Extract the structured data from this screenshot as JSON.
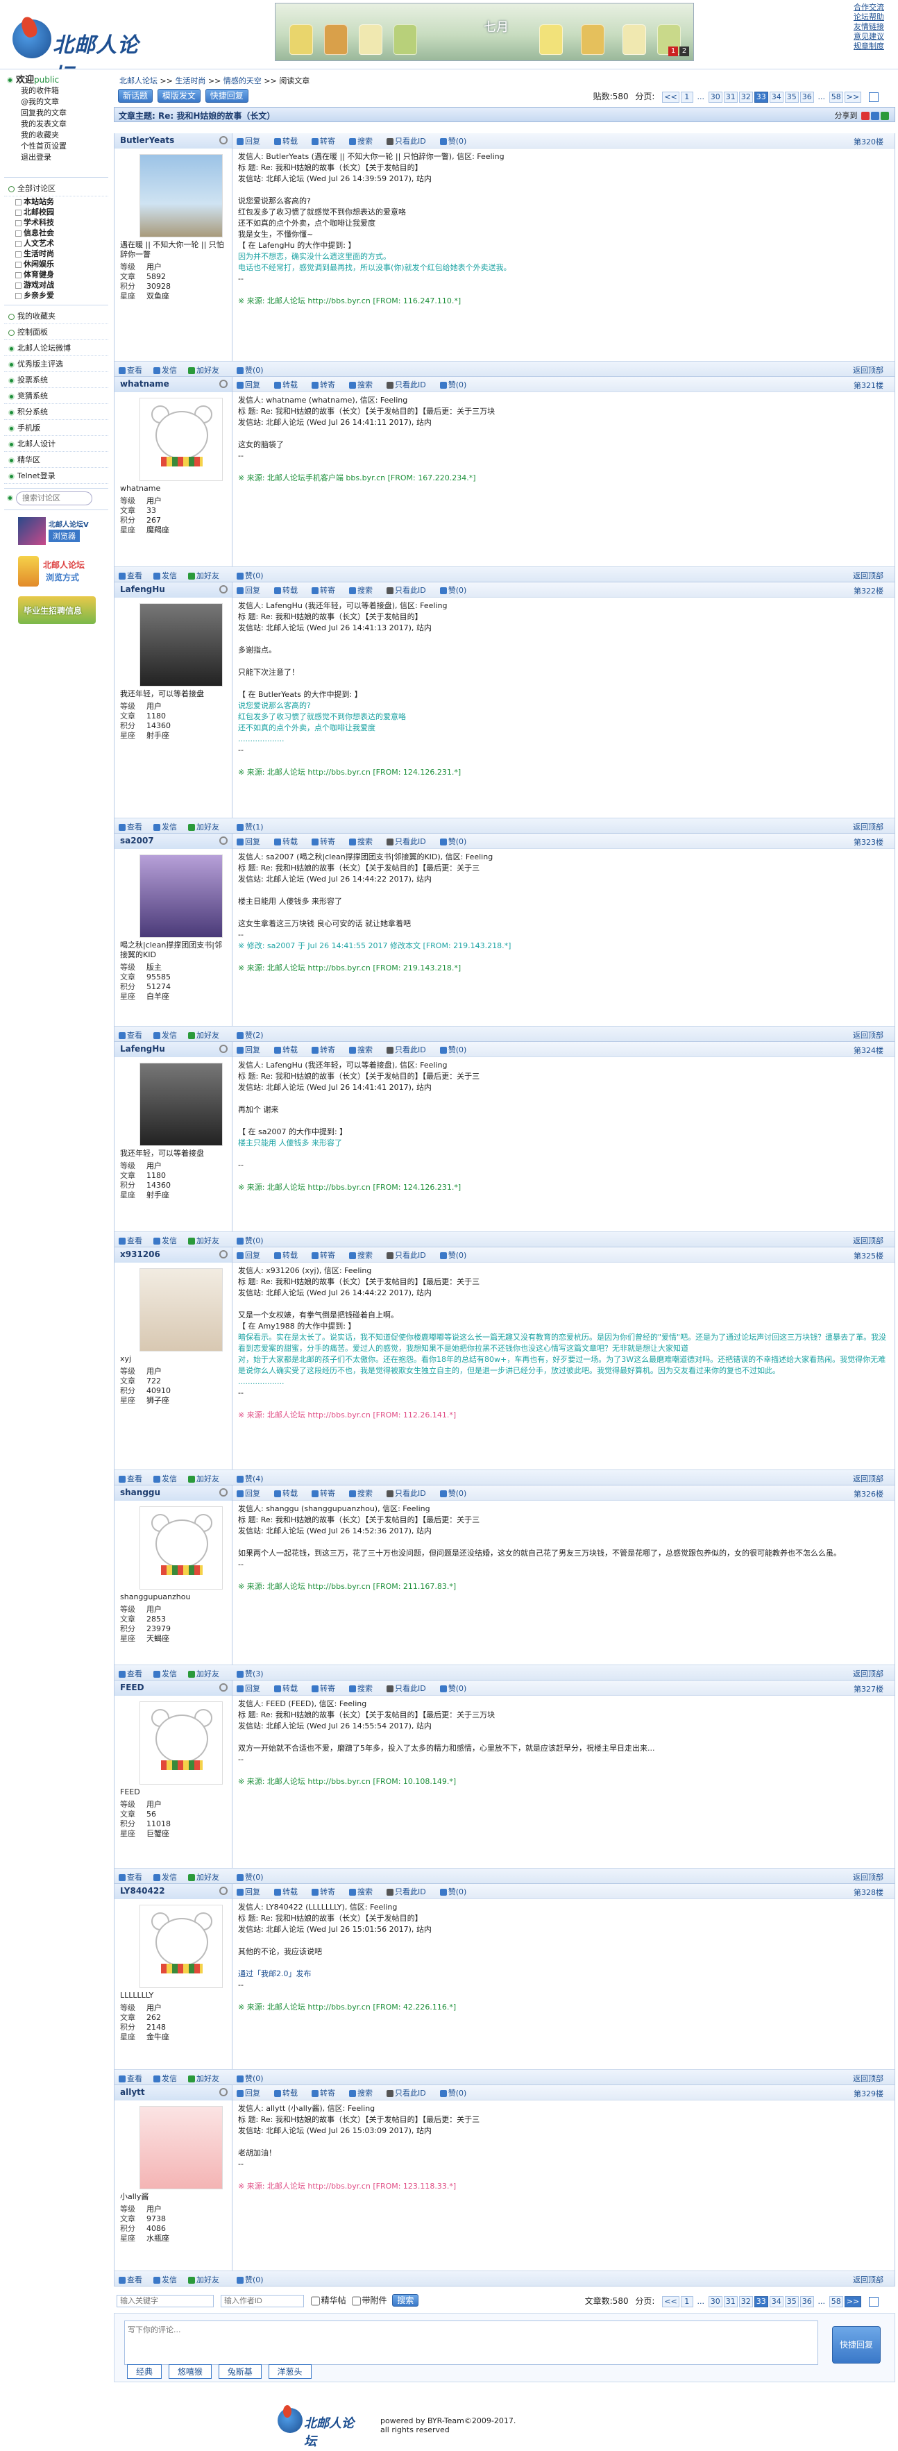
{
  "site": {
    "logo_text": "北邮人论坛"
  },
  "toplinks": [
    "合作交流",
    "论坛帮助",
    "友情链接",
    "意见建议",
    "规章制度"
  ],
  "banner": {
    "text": "七月",
    "nums": [
      "1",
      "2"
    ]
  },
  "sidebar": {
    "welcome": "欢迎",
    "public": "public",
    "user_links": [
      "我的收件箱",
      "@我的文章",
      "回复我的文章",
      "我的发表文章",
      "我的收藏夹",
      "个性首页设置",
      "退出登录"
    ],
    "all_sections": "全部讨论区",
    "sections": [
      "本站站务",
      "北邮校园",
      "学术科技",
      "信息社会",
      "人文艺术",
      "生活时尚",
      "休闲娱乐",
      "体育健身",
      "游戏对战",
      "乡亲乡爱"
    ],
    "items": [
      "我的收藏夹",
      "控制面板",
      "北邮人论坛微博",
      "优秀版主评选",
      "投票系统",
      "竞猜系统",
      "积分系统",
      "手机版",
      "北邮人设计",
      "精华区",
      "Telnet登录"
    ],
    "search_placeholder": "搜索讨论区",
    "promo1": "北邮人论坛V",
    "promo1b": "浏览器",
    "promo2": "北邮人论坛",
    "promo2b": "浏览方式",
    "promo3": "毕业生招聘信息"
  },
  "breadcrumb": [
    "北邮人论坛",
    ">>",
    "生活时尚",
    ">>",
    "情感的天空",
    ">>",
    "阅读文章"
  ],
  "toolbar": {
    "new_post": "新话题",
    "template_post": "模版发文",
    "quick_reply": "快捷回复",
    "post_count_label": "贴数:580",
    "pager_label": "分页:",
    "pages": [
      "<<",
      "1",
      "...",
      "30",
      "31",
      "32",
      "33",
      "34",
      "35",
      "36",
      "...",
      "58",
      ">>"
    ],
    "current": "33"
  },
  "title": "文章主题:  Re: 我和H姑娘的故事（长文）",
  "share_label": "分享到",
  "actions": [
    "回复",
    "转载",
    "转寄",
    "搜索",
    "只看此ID",
    "赞(0)"
  ],
  "foot_actions": [
    "查看",
    "发信",
    "加好友"
  ],
  "back_top": "返回顶部",
  "posts": [
    {
      "user": "ButlerYeats",
      "floor": "第320楼",
      "sig": "遇在暖 || 不知大你一轮 || 只怕辞你一瞥",
      "stats": {
        "等级": "用户",
        "文章": "5892",
        "积分": "30928",
        "星座": "双鱼座"
      },
      "like": "赞(0)",
      "lines": [
        "发信人: ButlerYeats (遇在暖 || 不知大你一轮 || 只怕辞你一瞥), 信区: Feeling",
        "标  题: Re: 我和H姑娘的故事（长文）【关于发帖目的】",
        "发信站: 北邮人论坛 (Wed Jul 26 14:39:59 2017), 站内",
        "",
        "说您爱说那么客高的?",
        "红包发多了收习惯了就感觉不到你想表达的爱意咯",
        "还不如真的点个外卖，点个咖啡让我爱度",
        "我是女生，不懂你懂~",
        "【 在 LafengHu 的大作中提到: 】"
      ],
      "quote": [
        "因为并不想恋，确实没什么遗这里面的方式。",
        "电话也不经常打，感觉调到最再找，所以没事(你)就发个红包给她表个外卖送我。"
      ],
      "after": [
        "--"
      ],
      "src": "※ 来源: 北邮人论坛 http://bbs.byr.cn [FROM: 116.247.110.*]"
    },
    {
      "user": "whatname",
      "floor": "第321楼",
      "sig": "whatname",
      "stats": {
        "等级": "用户",
        "文章": "33",
        "积分": "267",
        "星座": "魔羯座"
      },
      "like": "赞(0)",
      "lines": [
        "发信人: whatname (whatname), 信区: Feeling",
        "标  题: Re: 我和H姑娘的故事（长文）【关于发帖目的】【最后更：关于三万块",
        "发信站: 北邮人论坛 (Wed Jul 26 14:41:11 2017), 站内",
        "",
        "这女的脑袋了",
        "--"
      ],
      "quote": [],
      "after": [],
      "src": "※ 来源: 北邮人论坛手机客户端 bbs.byr.cn [FROM: 167.220.234.*]"
    },
    {
      "user": "LafengHu",
      "floor": "第322楼",
      "sig": "我还年轻，可以等着接盘",
      "stats": {
        "等级": "用户",
        "文章": "1180",
        "积分": "14360",
        "星座": "射手座"
      },
      "like": "赞(1)",
      "lines": [
        "发信人: LafengHu (我还年轻，可以等着接盘), 信区: Feeling",
        "标  题: Re: 我和H姑娘的故事（长文）【关于发帖目的】",
        "发信站: 北邮人论坛 (Wed Jul 26 14:41:13 2017), 站内",
        "",
        "多谢指点。",
        "",
        "只能下次注意了！",
        "",
        "【 在 ButlerYeats 的大作中提到: 】"
      ],
      "quote": [
        "说您爱说那么客高的?",
        "红包发多了收习惯了就感觉不到你想表达的爱意咯",
        "还不如真的点个外卖，点个咖啡让我爱度",
        "..................."
      ],
      "after": [
        "--"
      ],
      "src": "※ 来源: 北邮人论坛 http://bbs.byr.cn [FROM: 124.126.231.*]"
    },
    {
      "user": "sa2007",
      "floor": "第323楼",
      "sig": "喝之秋|clean撑撑团团支书|邻接翼的KID",
      "stats": {
        "等级": "版主",
        "文章": "95585",
        "积分": "51274",
        "星座": "白羊座"
      },
      "like": "赞(2)",
      "lines": [
        "发信人: sa2007 (喝之秋|clean撑撑团团支书|邻接翼的KID), 信区: Feeling",
        "标  题: Re: 我和H姑娘的故事（长文）【关于发帖目的】【最后更：关于三",
        "发信站: 北邮人论坛 (Wed Jul 26 14:44:22 2017), 站内",
        "",
        "楼主日能用  人傻钱多  来形容了",
        "",
        "这女生拿着这三万块钱  良心可安的话  就让她拿着吧",
        "--"
      ],
      "quote": [],
      "after": [],
      "edit": "※ 修改: sa2007 于 Jul 26 14:41:55 2017 修改本文 [FROM: 219.143.218.*]",
      "src": "※ 来源: 北邮人论坛 http://bbs.byr.cn [FROM: 219.143.218.*]"
    },
    {
      "user": "LafengHu",
      "floor": "第324楼",
      "sig": "我还年轻，可以等着接盘",
      "stats": {
        "等级": "用户",
        "文章": "1180",
        "积分": "14360",
        "星座": "射手座"
      },
      "like": "赞(0)",
      "lines": [
        "发信人: LafengHu (我还年轻，可以等着接盘), 信区: Feeling",
        "标  题: Re: 我和H姑娘的故事（长文）【关于发帖目的】【最后更：关于三",
        "发信站: 北邮人论坛 (Wed Jul 26 14:41:41 2017), 站内",
        "",
        "再加个 谢来",
        "",
        "【 在 sa2007 的大作中提到: 】"
      ],
      "quote": [
        "楼主只能用  人傻钱多  来形容了"
      ],
      "after": [
        "",
        "--"
      ],
      "src": "※ 来源: 北邮人论坛 http://bbs.byr.cn [FROM: 124.126.231.*]"
    },
    {
      "user": "x931206",
      "floor": "第325楼",
      "sig": "xyj",
      "stats": {
        "等级": "用户",
        "文章": "722",
        "积分": "40910",
        "星座": "狮子座"
      },
      "like": "赞(4)",
      "lines": [
        "发信人: x931206 (xyj), 信区: Feeling",
        "标  题: Re: 我和H姑娘的故事（长文）【关于发帖目的】【最后更：关于三",
        "发信站: 北邮人论坛 (Wed Jul 26 14:44:22 2017), 站内",
        "",
        "又是一个女权婊，有拳气倒是把钱碰着自上啊。",
        "【 在 Amy1988 的大作中提到: 】"
      ],
      "quote": [
        "暗保看示。实在是太长了。说实话，我不知道促使你楼鹿嘟嘟等说这么长一篇无趣又没有教育的恋爱杭历。是因为你们曾经的\"爱情\"吧。还是为了通过论坛声讨回这三万块钱？遭暴去了革。我没看到恋爱案的甜蜜，分手的痛苦。爱过人的感觉，我想知果不是她把你拉黑不还钱你也没这心情写这篇文章吧？无非就是想让大家知道",
        "对，始于大家都是北邮的孩子们不太傲你。还在抱怨。看你18年的总结有80w+，车再也有，好歹要过一场。为了3W这么最磨难嘲道德对吗。还把错误的不幸描述给大家看热闹。我觉得你无难是说你么人确实受了这段经历不也，我是觉得被欺女生独立自主的，但是退一步讲已经分手，放过彼此吧。我觉得最好算机。因为交友看过来你的复也不过如此。",
        "..................."
      ],
      "after": [
        "--"
      ],
      "src": "※ 来源: 北邮人论坛 http://bbs.byr.cn [FROM: 112.26.141.*]",
      "pink": true
    },
    {
      "user": "shanggu",
      "floor": "第326楼",
      "sig": "shanggupuanzhou",
      "stats": {
        "等级": "用户",
        "文章": "2853",
        "积分": "23979",
        "星座": "天蝎座"
      },
      "like": "赞(3)",
      "lines": [
        "发信人: shanggu (shanggupuanzhou), 信区: Feeling",
        "标  题: Re: 我和H姑娘的故事（长文）【关于发帖目的】【最后更：关于三",
        "发信站: 北邮人论坛 (Wed Jul 26 14:52:36 2017), 站内",
        "",
        "如果两个人一起花钱，到这三万，花了三十万也没问题，但问题是还没结婚，这女的就自己花了男友三万块钱，不管是花哪了，总感觉跟包养似的，女的很可能教养也不怎么么虽。",
        "--"
      ],
      "quote": [],
      "after": [],
      "src": "※ 来源: 北邮人论坛 http://bbs.byr.cn [FROM: 211.167.83.*]"
    },
    {
      "user": "FEED",
      "floor": "第327楼",
      "sig": "FEED",
      "stats": {
        "等级": "用户",
        "文章": "56",
        "积分": "11018",
        "星座": "巨蟹座"
      },
      "like": "赞(0)",
      "lines": [
        "发信人: FEED (FEED), 信区: Feeling",
        "标  题: Re: 我和H姑娘的故事（长文）【关于发帖目的】【最后更：关于三万块",
        "发信站: 北邮人论坛 (Wed Jul 26 14:55:54 2017), 站内",
        "",
        "双方一开始就不合适也不爱，磨蹭了5年多，投入了太多的精力和感情，心里放不下，就是应该赶早分，祝楼主早日走出来...",
        "--"
      ],
      "quote": [],
      "after": [],
      "src": "※ 来源: 北邮人论坛 http://bbs.byr.cn [FROM: 10.108.149.*]"
    },
    {
      "user": "LY840422",
      "floor": "第328楼",
      "sig": "LLLLLLLY",
      "stats": {
        "等级": "用户",
        "文章": "262",
        "积分": "2148",
        "星座": "金牛座"
      },
      "like": "赞(0)",
      "lines": [
        "发信人: LY840422 (LLLLLLLY), 信区: Feeling",
        "标  题: Re: 我和H姑娘的故事（长文）【关于发帖目的】",
        "发信站: 北邮人论坛 (Wed Jul 26 15:01:56 2017), 站内",
        "",
        "其他的不论，我应该说吧",
        "",
        "通过「我邮2.0」发布",
        "--"
      ],
      "quote": [],
      "after": [],
      "src": "※ 来源: 北邮人论坛 http://bbs.byr.cn [FROM: 42.226.116.*]"
    },
    {
      "user": "allytt",
      "floor": "第329楼",
      "sig": "小ally酱",
      "stats": {
        "等级": "用户",
        "文章": "9738",
        "积分": "4086",
        "星座": "水瓶座"
      },
      "like": "赞(0)",
      "lines": [
        "发信人: allytt (小ally酱), 信区: Feeling",
        "标  题: Re: 我和H姑娘的故事（长文）【关于发帖目的】【最后更：关于三",
        "发信站: 北邮人论坛 (Wed Jul 26 15:03:09 2017), 站内",
        "",
        "老胡加油！",
        "--"
      ],
      "quote": [],
      "after": [],
      "src": "※ 来源: 北邮人论坛 http://bbs.byr.cn [FROM: 123.118.33.*]",
      "pink": true
    }
  ],
  "bottom": {
    "search_user_placeholder": "输入关键字",
    "search_id_placeholder": "输入作者ID",
    "opt1": "精华帖",
    "opt2": "带附件",
    "search_btn": "搜索",
    "post_count_label": "文章数:580",
    "pager_label": "分页:"
  },
  "reply": {
    "placeholder": "写下你的评论...",
    "send": "快捷回复",
    "emos": [
      "经典",
      "悠嘻猴",
      "兔斯基",
      "洋葱头"
    ]
  },
  "footer": {
    "line1": "powered by BYR-Team©2009-2017.",
    "line2": "all rights reserved"
  },
  "colors": {
    "accent": "#3a78c8",
    "link": "#1d4f91",
    "source_green": "#1d8f3a",
    "quote_teal": "#1ca3a3"
  }
}
